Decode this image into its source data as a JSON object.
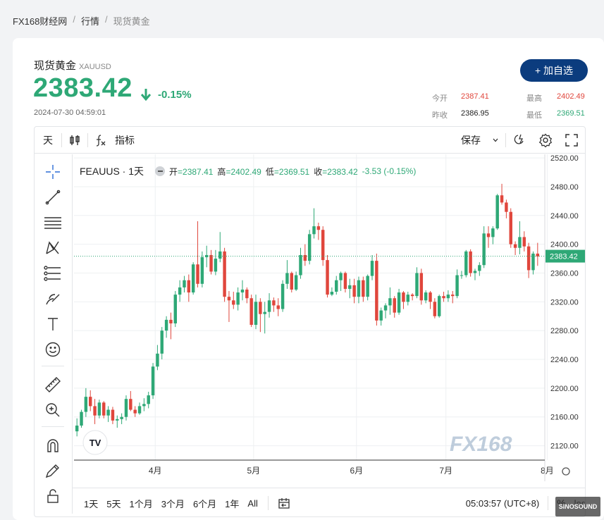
{
  "breadcrumb": {
    "home": "FX168财经网",
    "section": "行情",
    "current": "现货黄金",
    "sep": "/"
  },
  "header": {
    "name": "现货黄金",
    "symbol": "XAUUSD",
    "price": "2383.42",
    "arrow": "🡇",
    "change": "-0.15%",
    "timestamp": "2024-07-30 04:59:01",
    "add_watchlist": "+ 加自选",
    "quotes": [
      {
        "label": "今开",
        "value": "2387.41",
        "color": "#e0463c"
      },
      {
        "label": "最高",
        "value": "2402.49",
        "color": "#e0463c"
      },
      {
        "label": "昨收",
        "value": "2386.95",
        "color": "#222222"
      },
      {
        "label": "最低",
        "value": "2369.51",
        "color": "#2ea876"
      }
    ]
  },
  "toolbar": {
    "interval": "天",
    "indicators": "指标",
    "save": "保存"
  },
  "legend": {
    "name": "FEAUUS · 1天",
    "open_label": "开",
    "open": "=2387.41",
    "high_label": "高",
    "high": "=2402.49",
    "low_label": "低",
    "low": "=2369.51",
    "close_label": "收",
    "close": "=2383.42",
    "change": "-3.53 (-0.15%)"
  },
  "bottombar": {
    "ranges": [
      "1天",
      "5天",
      "1个月",
      "3个月",
      "6个月",
      "1年",
      "All"
    ],
    "clock": "05:03:57 (UTC+8)",
    "percent": "%",
    "log": "log"
  },
  "watermark": "FX168",
  "sinosound": "SINOSOUND",
  "chart_data": {
    "type": "candlestick",
    "title": "FEAUUS · 1天",
    "ylim": [
      2100,
      2525
    ],
    "y_ticks": [
      2120,
      2160,
      2200,
      2240,
      2280,
      2320,
      2360,
      2400,
      2440,
      2480,
      2520
    ],
    "x_tick_labels": [
      "4月",
      "5月",
      "6月",
      "7月",
      "8月"
    ],
    "last_price": "2383.42",
    "colors": {
      "up": "#2ea876",
      "down": "#e0463c",
      "last_line": "#2ea876"
    },
    "candles": [
      {
        "date": "2024-03-05",
        "o": 2140,
        "h": 2158,
        "l": 2133,
        "c": 2148
      },
      {
        "date": "2024-03-06",
        "o": 2148,
        "h": 2170,
        "l": 2145,
        "c": 2167
      },
      {
        "date": "2024-03-07",
        "o": 2167,
        "h": 2200,
        "l": 2160,
        "c": 2188
      },
      {
        "date": "2024-03-08",
        "o": 2188,
        "h": 2197,
        "l": 2168,
        "c": 2175
      },
      {
        "date": "2024-03-11",
        "o": 2175,
        "h": 2185,
        "l": 2150,
        "c": 2162
      },
      {
        "date": "2024-03-12",
        "o": 2162,
        "h": 2184,
        "l": 2158,
        "c": 2180
      },
      {
        "date": "2024-03-13",
        "o": 2180,
        "h": 2182,
        "l": 2158,
        "c": 2162
      },
      {
        "date": "2024-03-14",
        "o": 2162,
        "h": 2175,
        "l": 2153,
        "c": 2170
      },
      {
        "date": "2024-03-15",
        "o": 2170,
        "h": 2174,
        "l": 2150,
        "c": 2155
      },
      {
        "date": "2024-03-18",
        "o": 2155,
        "h": 2162,
        "l": 2145,
        "c": 2157
      },
      {
        "date": "2024-03-19",
        "o": 2157,
        "h": 2165,
        "l": 2150,
        "c": 2160
      },
      {
        "date": "2024-03-20",
        "o": 2160,
        "h": 2190,
        "l": 2155,
        "c": 2185
      },
      {
        "date": "2024-03-21",
        "o": 2185,
        "h": 2196,
        "l": 2168,
        "c": 2170
      },
      {
        "date": "2024-03-22",
        "o": 2170,
        "h": 2175,
        "l": 2160,
        "c": 2165
      },
      {
        "date": "2024-03-25",
        "o": 2165,
        "h": 2180,
        "l": 2163,
        "c": 2175
      },
      {
        "date": "2024-03-26",
        "o": 2175,
        "h": 2186,
        "l": 2168,
        "c": 2178
      },
      {
        "date": "2024-03-27",
        "o": 2178,
        "h": 2195,
        "l": 2172,
        "c": 2190
      },
      {
        "date": "2024-03-28",
        "o": 2190,
        "h": 2235,
        "l": 2185,
        "c": 2230
      },
      {
        "date": "2024-04-01",
        "o": 2230,
        "h": 2260,
        "l": 2225,
        "c": 2248
      },
      {
        "date": "2024-04-02",
        "o": 2248,
        "h": 2285,
        "l": 2240,
        "c": 2280
      },
      {
        "date": "2024-04-03",
        "o": 2280,
        "h": 2300,
        "l": 2270,
        "c": 2295
      },
      {
        "date": "2024-04-04",
        "o": 2295,
        "h": 2305,
        "l": 2268,
        "c": 2290
      },
      {
        "date": "2024-04-05",
        "o": 2290,
        "h": 2335,
        "l": 2285,
        "c": 2330
      },
      {
        "date": "2024-04-08",
        "o": 2330,
        "h": 2350,
        "l": 2320,
        "c": 2340
      },
      {
        "date": "2024-04-09",
        "o": 2340,
        "h": 2356,
        "l": 2333,
        "c": 2350
      },
      {
        "date": "2024-04-10",
        "o": 2350,
        "h": 2358,
        "l": 2320,
        "c": 2333
      },
      {
        "date": "2024-04-11",
        "o": 2333,
        "h": 2375,
        "l": 2330,
        "c": 2372
      },
      {
        "date": "2024-04-12",
        "o": 2372,
        "h": 2432,
        "l": 2340,
        "c": 2345
      },
      {
        "date": "2024-04-15",
        "o": 2345,
        "h": 2390,
        "l": 2340,
        "c": 2382
      },
      {
        "date": "2024-04-16",
        "o": 2382,
        "h": 2398,
        "l": 2368,
        "c": 2385
      },
      {
        "date": "2024-04-17",
        "o": 2385,
        "h": 2392,
        "l": 2358,
        "c": 2362
      },
      {
        "date": "2024-04-18",
        "o": 2362,
        "h": 2392,
        "l": 2357,
        "c": 2380
      },
      {
        "date": "2024-04-19",
        "o": 2380,
        "h": 2417,
        "l": 2375,
        "c": 2390
      },
      {
        "date": "2024-04-22",
        "o": 2390,
        "h": 2395,
        "l": 2320,
        "c": 2327
      },
      {
        "date": "2024-04-23",
        "o": 2327,
        "h": 2335,
        "l": 2292,
        "c": 2322
      },
      {
        "date": "2024-04-24",
        "o": 2322,
        "h": 2334,
        "l": 2310,
        "c": 2316
      },
      {
        "date": "2024-04-25",
        "o": 2316,
        "h": 2340,
        "l": 2308,
        "c": 2333
      },
      {
        "date": "2024-04-26",
        "o": 2333,
        "h": 2350,
        "l": 2322,
        "c": 2337
      },
      {
        "date": "2024-04-29",
        "o": 2337,
        "h": 2340,
        "l": 2318,
        "c": 2325
      },
      {
        "date": "2024-04-30",
        "o": 2325,
        "h": 2330,
        "l": 2285,
        "c": 2288
      },
      {
        "date": "2024-05-01",
        "o": 2288,
        "h": 2330,
        "l": 2282,
        "c": 2320
      },
      {
        "date": "2024-05-02",
        "o": 2320,
        "h": 2325,
        "l": 2278,
        "c": 2303
      },
      {
        "date": "2024-05-03",
        "o": 2303,
        "h": 2320,
        "l": 2276,
        "c": 2306
      },
      {
        "date": "2024-05-06",
        "o": 2306,
        "h": 2332,
        "l": 2298,
        "c": 2322
      },
      {
        "date": "2024-05-07",
        "o": 2322,
        "h": 2326,
        "l": 2306,
        "c": 2315
      },
      {
        "date": "2024-05-08",
        "o": 2315,
        "h": 2325,
        "l": 2300,
        "c": 2310
      },
      {
        "date": "2024-05-09",
        "o": 2310,
        "h": 2350,
        "l": 2306,
        "c": 2345
      },
      {
        "date": "2024-05-10",
        "o": 2345,
        "h": 2378,
        "l": 2338,
        "c": 2360
      },
      {
        "date": "2024-05-13",
        "o": 2360,
        "h": 2362,
        "l": 2333,
        "c": 2337
      },
      {
        "date": "2024-05-14",
        "o": 2337,
        "h": 2362,
        "l": 2335,
        "c": 2357
      },
      {
        "date": "2024-05-15",
        "o": 2357,
        "h": 2395,
        "l": 2352,
        "c": 2385
      },
      {
        "date": "2024-05-16",
        "o": 2385,
        "h": 2400,
        "l": 2370,
        "c": 2377
      },
      {
        "date": "2024-05-17",
        "o": 2377,
        "h": 2420,
        "l": 2372,
        "c": 2414
      },
      {
        "date": "2024-05-20",
        "o": 2414,
        "h": 2450,
        "l": 2408,
        "c": 2425
      },
      {
        "date": "2024-05-21",
        "o": 2425,
        "h": 2430,
        "l": 2406,
        "c": 2420
      },
      {
        "date": "2024-05-22",
        "o": 2420,
        "h": 2425,
        "l": 2370,
        "c": 2378
      },
      {
        "date": "2024-05-23",
        "o": 2378,
        "h": 2385,
        "l": 2326,
        "c": 2330
      },
      {
        "date": "2024-05-24",
        "o": 2330,
        "h": 2340,
        "l": 2328,
        "c": 2334
      },
      {
        "date": "2024-05-27",
        "o": 2334,
        "h": 2356,
        "l": 2330,
        "c": 2350
      },
      {
        "date": "2024-05-28",
        "o": 2350,
        "h": 2362,
        "l": 2335,
        "c": 2360
      },
      {
        "date": "2024-05-29",
        "o": 2360,
        "h": 2362,
        "l": 2333,
        "c": 2338
      },
      {
        "date": "2024-05-30",
        "o": 2338,
        "h": 2352,
        "l": 2325,
        "c": 2343
      },
      {
        "date": "2024-05-31",
        "o": 2343,
        "h": 2352,
        "l": 2318,
        "c": 2327
      },
      {
        "date": "2024-06-03",
        "o": 2327,
        "h": 2355,
        "l": 2318,
        "c": 2350
      },
      {
        "date": "2024-06-04",
        "o": 2350,
        "h": 2355,
        "l": 2320,
        "c": 2327
      },
      {
        "date": "2024-06-05",
        "o": 2327,
        "h": 2358,
        "l": 2322,
        "c": 2356
      },
      {
        "date": "2024-06-06",
        "o": 2356,
        "h": 2385,
        "l": 2350,
        "c": 2377
      },
      {
        "date": "2024-06-07",
        "o": 2377,
        "h": 2387,
        "l": 2287,
        "c": 2294
      },
      {
        "date": "2024-06-10",
        "o": 2294,
        "h": 2312,
        "l": 2287,
        "c": 2308
      },
      {
        "date": "2024-06-11",
        "o": 2308,
        "h": 2318,
        "l": 2297,
        "c": 2315
      },
      {
        "date": "2024-06-12",
        "o": 2315,
        "h": 2340,
        "l": 2302,
        "c": 2325
      },
      {
        "date": "2024-06-13",
        "o": 2325,
        "h": 2328,
        "l": 2298,
        "c": 2305
      },
      {
        "date": "2024-06-14",
        "o": 2305,
        "h": 2338,
        "l": 2302,
        "c": 2333
      },
      {
        "date": "2024-06-17",
        "o": 2333,
        "h": 2335,
        "l": 2310,
        "c": 2320
      },
      {
        "date": "2024-06-18",
        "o": 2320,
        "h": 2334,
        "l": 2315,
        "c": 2330
      },
      {
        "date": "2024-06-19",
        "o": 2330,
        "h": 2332,
        "l": 2322,
        "c": 2328
      },
      {
        "date": "2024-06-20",
        "o": 2328,
        "h": 2368,
        "l": 2325,
        "c": 2360
      },
      {
        "date": "2024-06-21",
        "o": 2360,
        "h": 2366,
        "l": 2316,
        "c": 2322
      },
      {
        "date": "2024-06-24",
        "o": 2322,
        "h": 2336,
        "l": 2318,
        "c": 2333
      },
      {
        "date": "2024-06-25",
        "o": 2333,
        "h": 2335,
        "l": 2310,
        "c": 2320
      },
      {
        "date": "2024-06-26",
        "o": 2320,
        "h": 2325,
        "l": 2297,
        "c": 2300
      },
      {
        "date": "2024-06-27",
        "o": 2300,
        "h": 2330,
        "l": 2298,
        "c": 2328
      },
      {
        "date": "2024-06-28",
        "o": 2328,
        "h": 2334,
        "l": 2320,
        "c": 2325
      },
      {
        "date": "2024-07-01",
        "o": 2325,
        "h": 2336,
        "l": 2320,
        "c": 2330
      },
      {
        "date": "2024-07-02",
        "o": 2330,
        "h": 2335,
        "l": 2318,
        "c": 2328
      },
      {
        "date": "2024-07-03",
        "o": 2328,
        "h": 2365,
        "l": 2325,
        "c": 2357
      },
      {
        "date": "2024-07-04",
        "o": 2357,
        "h": 2363,
        "l": 2352,
        "c": 2357
      },
      {
        "date": "2024-07-05",
        "o": 2357,
        "h": 2392,
        "l": 2354,
        "c": 2390
      },
      {
        "date": "2024-07-08",
        "o": 2390,
        "h": 2393,
        "l": 2355,
        "c": 2360
      },
      {
        "date": "2024-07-09",
        "o": 2360,
        "h": 2366,
        "l": 2350,
        "c": 2363
      },
      {
        "date": "2024-07-10",
        "o": 2363,
        "h": 2375,
        "l": 2356,
        "c": 2371
      },
      {
        "date": "2024-07-11",
        "o": 2371,
        "h": 2425,
        "l": 2367,
        "c": 2415
      },
      {
        "date": "2024-07-12",
        "o": 2415,
        "h": 2425,
        "l": 2395,
        "c": 2410
      },
      {
        "date": "2024-07-15",
        "o": 2410,
        "h": 2425,
        "l": 2400,
        "c": 2422
      },
      {
        "date": "2024-07-16",
        "o": 2422,
        "h": 2470,
        "l": 2420,
        "c": 2468
      },
      {
        "date": "2024-07-17",
        "o": 2468,
        "h": 2484,
        "l": 2455,
        "c": 2458
      },
      {
        "date": "2024-07-18",
        "o": 2458,
        "h": 2462,
        "l": 2436,
        "c": 2445
      },
      {
        "date": "2024-07-19",
        "o": 2445,
        "h": 2450,
        "l": 2395,
        "c": 2400
      },
      {
        "date": "2024-07-22",
        "o": 2400,
        "h": 2404,
        "l": 2385,
        "c": 2395
      },
      {
        "date": "2024-07-23",
        "o": 2395,
        "h": 2432,
        "l": 2386,
        "c": 2410
      },
      {
        "date": "2024-07-24",
        "o": 2410,
        "h": 2418,
        "l": 2390,
        "c": 2397
      },
      {
        "date": "2024-07-25",
        "o": 2397,
        "h": 2402,
        "l": 2353,
        "c": 2364
      },
      {
        "date": "2024-07-26",
        "o": 2364,
        "h": 2390,
        "l": 2358,
        "c": 2387
      },
      {
        "date": "2024-07-29",
        "o": 2387,
        "h": 2402,
        "l": 2370,
        "c": 2383
      }
    ]
  }
}
